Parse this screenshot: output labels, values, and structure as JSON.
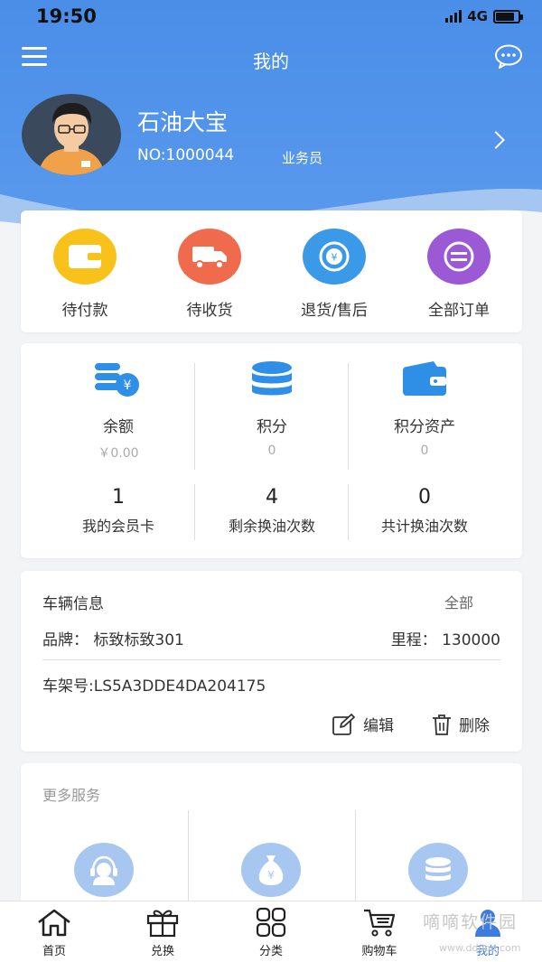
{
  "status_bar": {
    "time": "19:50",
    "network": "4G",
    "battery_level": 0.85
  },
  "nav": {
    "title": "我的",
    "menu_icon": "menu-icon",
    "message_icon": "message-icon"
  },
  "profile": {
    "name": "石油大宝",
    "number": "NO:1000044",
    "role": "业务员"
  },
  "orders": [
    {
      "label": "待付款",
      "icon": "wallet-icon",
      "color": "#f5b800"
    },
    {
      "label": "待收货",
      "icon": "truck-icon",
      "color": "#f06a4e"
    },
    {
      "label": "退货/售后",
      "icon": "refund-icon",
      "color": "#3a9ae8"
    },
    {
      "label": "全部订单",
      "icon": "orders-icon",
      "color": "#9b59d6"
    }
  ],
  "wallet": {
    "balance": {
      "label": "余额",
      "value": "￥0.00"
    },
    "points": {
      "label": "积分",
      "value": "0"
    },
    "points_assets": {
      "label": "积分资产",
      "value": "0"
    },
    "member_cards": {
      "count": "1",
      "label": "我的会员卡"
    },
    "remaining_oil_changes": {
      "count": "4",
      "label": "剩余换油次数"
    },
    "total_oil_changes": {
      "count": "0",
      "label": "共计换油次数"
    }
  },
  "vehicle": {
    "title": "车辆信息",
    "all_label": "全部",
    "brand": "品牌：  标致标致301",
    "mileage": "里程：  130000",
    "vin": "车架号:LS5A3DDE4DA204175",
    "edit_label": "编辑",
    "delete_label": "删除"
  },
  "services": {
    "title": "更多服务"
  },
  "tabs": [
    {
      "label": "首页",
      "icon": "home-icon"
    },
    {
      "label": "兑换",
      "icon": "gift-icon"
    },
    {
      "label": "分类",
      "icon": "grid-icon"
    },
    {
      "label": "购物车",
      "icon": "cart-icon"
    },
    {
      "label": "我的",
      "icon": "user-icon",
      "active": true
    }
  ],
  "watermark": {
    "text": "嘀嘀软件园",
    "url": "www.ddooo.com"
  },
  "colors": {
    "primary": "#4a8ee8",
    "tab_active": "#3b7ce0",
    "icon_blue": "#2f8fe6"
  }
}
